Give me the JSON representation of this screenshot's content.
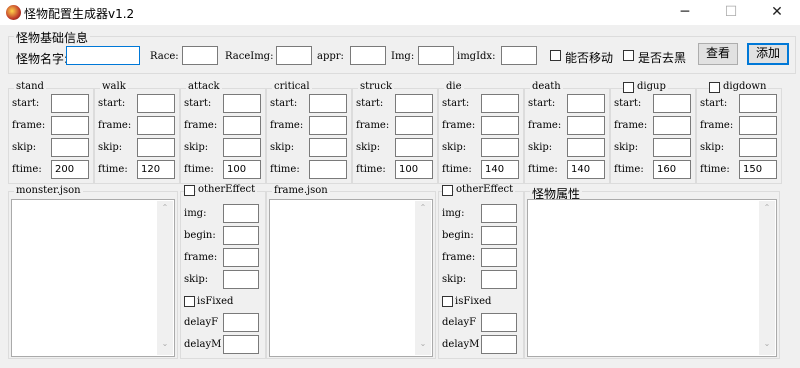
{
  "window": {
    "title": "怪物配置生成器v1.2",
    "min_icon": "─",
    "max_icon": "☐",
    "close_icon": "✕"
  },
  "basic": {
    "legend": "怪物基础信息",
    "name_label": "怪物名字:",
    "race_label": "Race:",
    "raceimg_label": "RaceImg:",
    "appr_label": "appr:",
    "img_label": "Img:",
    "imgidx_label": "imgIdx:",
    "can_move_label": "能否移动",
    "remove_black_label": "是否去黑",
    "view_button": "查看",
    "add_button": "添加"
  },
  "actions": [
    {
      "name": "stand",
      "ftime": "200"
    },
    {
      "name": "walk",
      "ftime": "120"
    },
    {
      "name": "attack",
      "ftime": "100"
    },
    {
      "name": "critical",
      "ftime": ""
    },
    {
      "name": "struck",
      "ftime": "100"
    },
    {
      "name": "die",
      "ftime": "140"
    },
    {
      "name": "death",
      "ftime": "140"
    },
    {
      "name": "digup",
      "ftime": "160"
    },
    {
      "name": "digdown",
      "ftime": "150"
    }
  ],
  "field_labels": {
    "start": "start:",
    "frame": "frame:",
    "skip": "skip:",
    "ftime": "ftime:"
  },
  "panels": {
    "monster_json": "monster.json",
    "frame_json": "frame.json",
    "monster_attr": "怪物属性"
  },
  "effect": {
    "other_effect": "otherEffect",
    "img": "img:",
    "begin": "begin:",
    "frame": "frame:",
    "skip": "skip:",
    "is_fixed": "isFixed",
    "delay_f": "delayF",
    "delay_m": "delayM"
  },
  "scroll": {
    "up": "⌃",
    "down": "⌄"
  }
}
